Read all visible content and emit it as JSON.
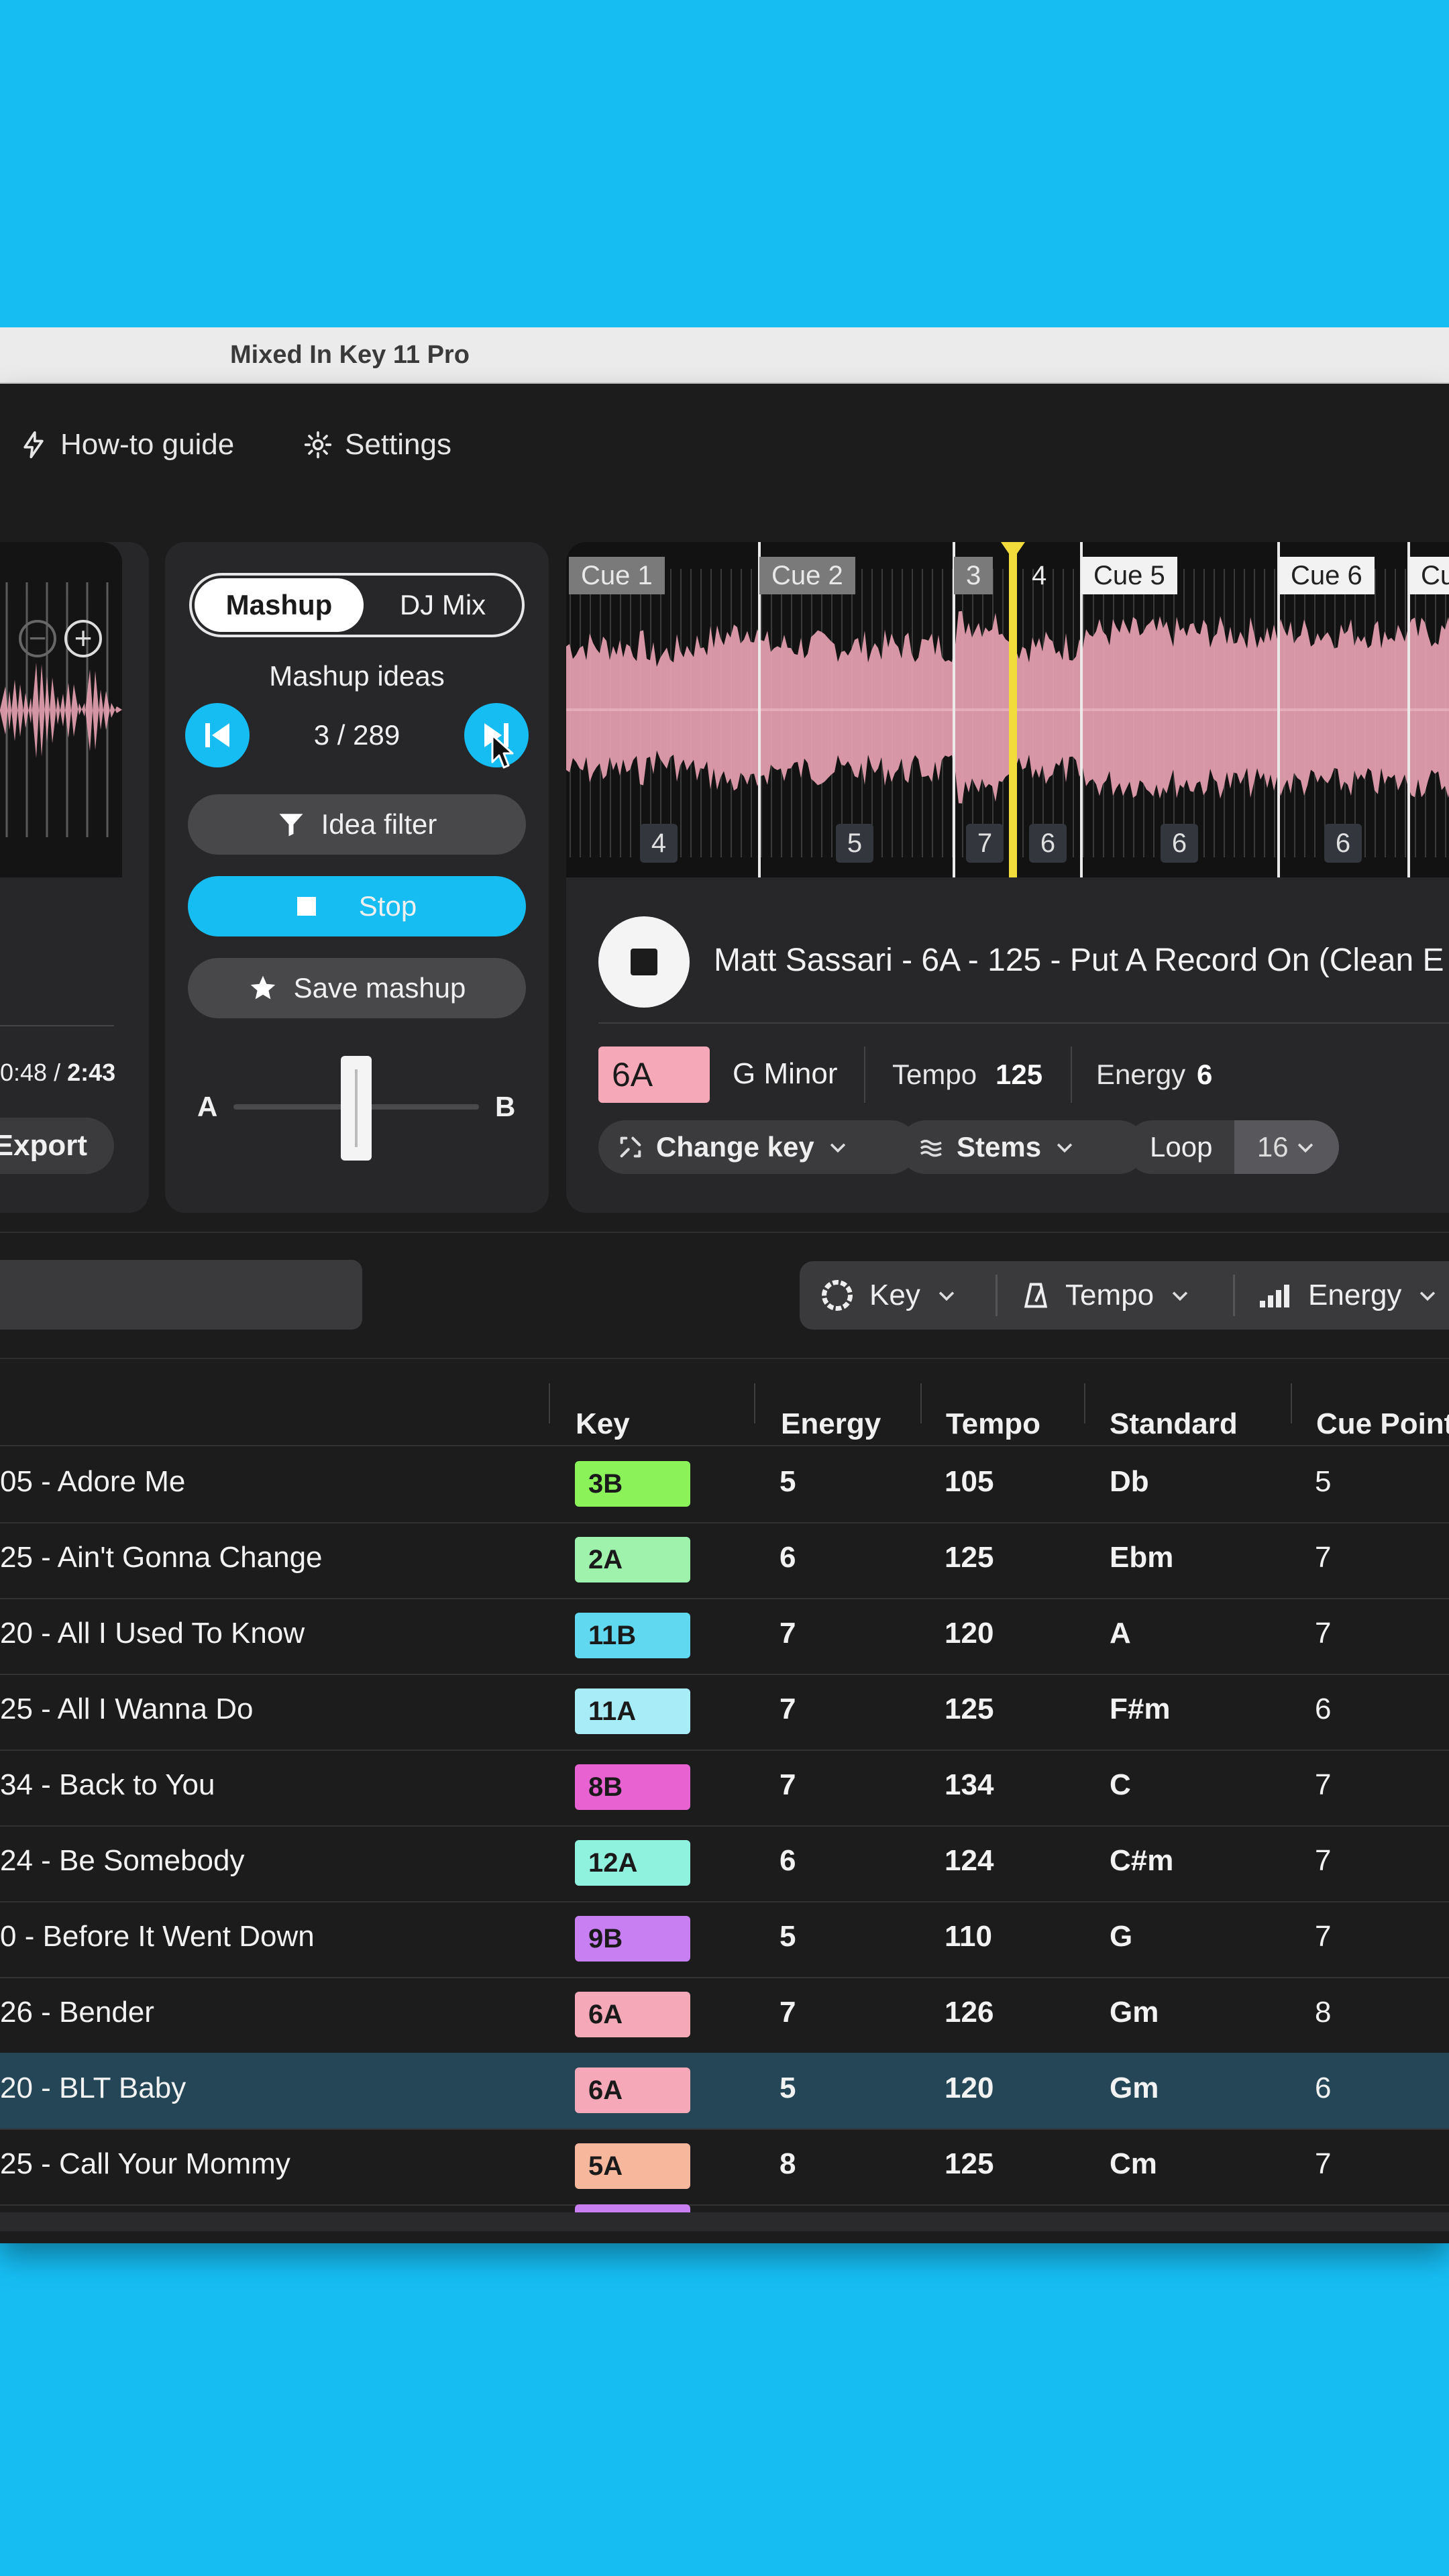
{
  "window": {
    "title": "Mixed In Key 11 Pro"
  },
  "nav": {
    "howto": "How-to guide",
    "settings": "Settings"
  },
  "left_deck": {
    "time_elapsed": "0:48",
    "time_sep": " / ",
    "time_total": "2:43",
    "export_label": "Export"
  },
  "mashup": {
    "tab_mashup": "Mashup",
    "tab_djmix": "DJ Mix",
    "ideas_label": "Mashup ideas",
    "counter": "3 / 289",
    "idea_filter": "Idea filter",
    "stop": "Stop",
    "save": "Save mashup",
    "crossfader_a": "A",
    "crossfader_b": "B",
    "crossfader_position": 0.5
  },
  "right_deck": {
    "cues": [
      "Cue 1",
      "Cue 2",
      "3",
      "4",
      "Cue 5",
      "Cue 6",
      "Cu"
    ],
    "beat_numbers": [
      "4",
      "5",
      "7",
      "6",
      "6",
      "6"
    ],
    "track_title": "Matt Sassari - 6A - 125 - Put A Record On (Clean E",
    "key": "6A",
    "key_name": "G Minor",
    "tempo_label": "Tempo",
    "tempo_value": "125",
    "energy_label": "Energy",
    "energy_value": "6",
    "change_key": "Change key",
    "stems": "Stems",
    "loop_label": "Loop",
    "loop_value": "16",
    "colors": {
      "accent": "#16bdf3",
      "playhead": "#f2dc3c",
      "waveform": "#e8a2b2"
    }
  },
  "filters": {
    "key": "Key",
    "tempo": "Tempo",
    "energy": "Energy"
  },
  "table": {
    "columns": [
      "Key",
      "Energy",
      "Tempo",
      "Standard",
      "Cue Point"
    ],
    "rows": [
      {
        "title": "05 - Adore Me",
        "key": "3B",
        "key_color": "#8bf25a",
        "energy": "5",
        "tempo": "105",
        "standard": "Db",
        "cue": "5"
      },
      {
        "title": "25 - Ain't Gonna Change",
        "key": "2A",
        "key_color": "#9ff2ac",
        "energy": "6",
        "tempo": "125",
        "standard": "Ebm",
        "cue": "7"
      },
      {
        "title": "20 - All I Used To Know",
        "key": "11B",
        "key_color": "#5fd8f0",
        "energy": "7",
        "tempo": "120",
        "standard": "A",
        "cue": "7"
      },
      {
        "title": "25 - All I Wanna Do",
        "key": "11A",
        "key_color": "#a7ecf7",
        "energy": "7",
        "tempo": "125",
        "standard": "F#m",
        "cue": "6"
      },
      {
        "title": "34 - Back to You",
        "key": "8B",
        "key_color": "#e862d2",
        "energy": "7",
        "tempo": "134",
        "standard": "C",
        "cue": "7"
      },
      {
        "title": "24 - Be Somebody",
        "key": "12A",
        "key_color": "#8ff2df",
        "energy": "6",
        "tempo": "124",
        "standard": "C#m",
        "cue": "7"
      },
      {
        "title": "0 - Before It Went Down",
        "key": "9B",
        "key_color": "#c77ff2",
        "energy": "5",
        "tempo": "110",
        "standard": "G",
        "cue": "7"
      },
      {
        "title": "26 - Bender",
        "key": "6A",
        "key_color": "#f5a8b8",
        "energy": "7",
        "tempo": "126",
        "standard": "Gm",
        "cue": "8"
      },
      {
        "title": "20 - BLT Baby",
        "key": "6A",
        "key_color": "#f5a8b8",
        "energy": "5",
        "tempo": "120",
        "standard": "Gm",
        "cue": "6"
      },
      {
        "title": "25 - Call Your Mommy",
        "key": "5A",
        "key_color": "#f7b79d",
        "energy": "8",
        "tempo": "125",
        "standard": "Cm",
        "cue": "7"
      }
    ],
    "highlighted_row": 8
  }
}
